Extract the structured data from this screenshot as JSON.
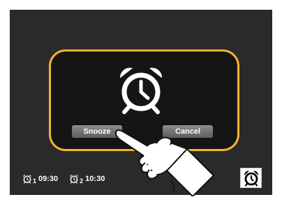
{
  "dialog": {
    "icon": "alarm-clock-icon",
    "snooze_label": "Snooze",
    "cancel_label": "Cancel"
  },
  "status_bar": {
    "alarms": [
      {
        "index": "1",
        "time": "09:30",
        "icon": "alarm-clock-icon"
      },
      {
        "index": "2",
        "time": "10:30",
        "icon": "alarm-clock-icon"
      }
    ]
  },
  "corner": {
    "icon": "alarm-clock-icon"
  },
  "overlay": {
    "icon": "pointing-hand-icon"
  },
  "colors": {
    "screen_bg": "#2a2a2a",
    "dialog_bg": "#151515",
    "accent": "#f4b52f",
    "button": "#6f6f6f"
  }
}
